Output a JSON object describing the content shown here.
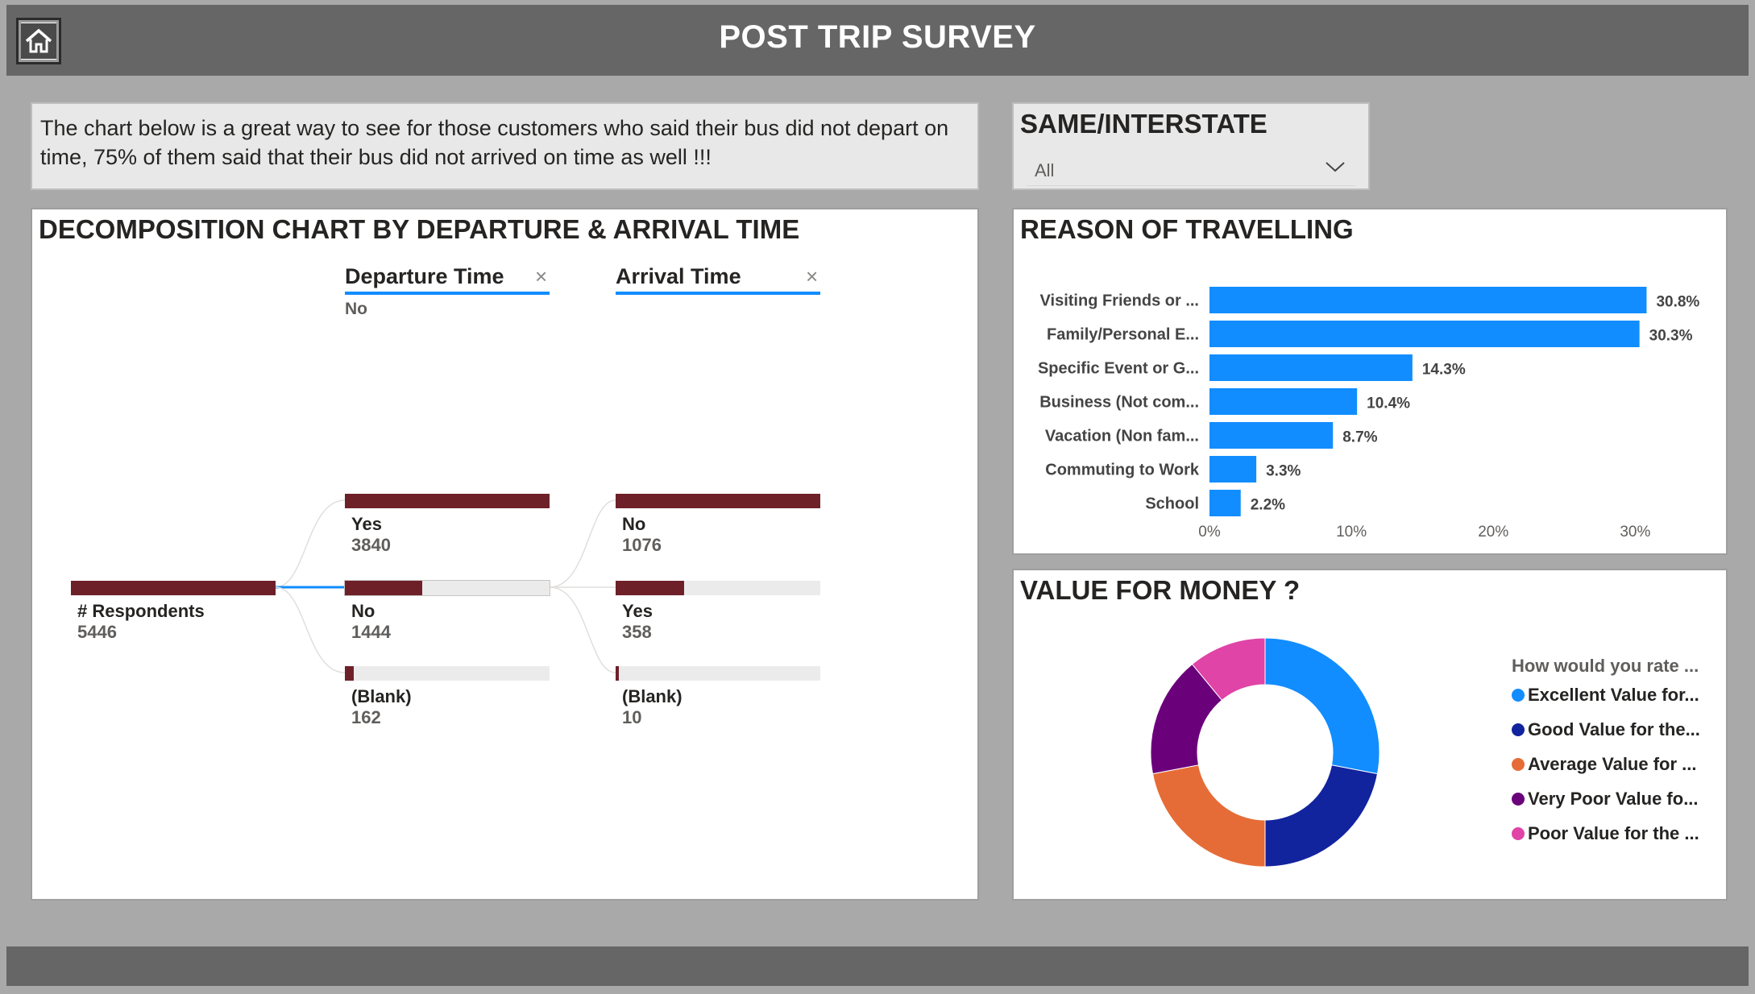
{
  "header": {
    "title": "POST TRIP SURVEY"
  },
  "info_text": "The chart below is a great way to see for those customers who said their bus did not depart on time, 75% of them said that their bus did not arrived on time as well !!!",
  "slicer": {
    "title": "SAME/INTERSTATE",
    "selected": "All"
  },
  "decomposition": {
    "title": "DECOMPOSITION CHART BY DEPARTURE & ARRIVAL TIME",
    "root": {
      "label": "# Respondents",
      "value": "5446",
      "fraction": 1.0
    },
    "level1": {
      "header": "Departure Time",
      "filter": "No",
      "nodes": [
        {
          "label": "Yes",
          "value": "3840",
          "fraction": 1.0
        },
        {
          "label": "No",
          "value": "1444",
          "fraction": 0.376
        },
        {
          "label": "(Blank)",
          "value": "162",
          "fraction": 0.042
        }
      ]
    },
    "level2": {
      "header": "Arrival Time",
      "nodes": [
        {
          "label": "No",
          "value": "1076",
          "fraction": 1.0
        },
        {
          "label": "Yes",
          "value": "358",
          "fraction": 0.333
        },
        {
          "label": "(Blank)",
          "value": "10",
          "fraction": 0.009
        }
      ]
    }
  },
  "reason_panel": {
    "title": "REASON OF TRAVELLING"
  },
  "value_panel": {
    "title": "VALUE FOR MONEY ?",
    "legend_title": "How would you rate ...",
    "legend": [
      {
        "label": "Excellent Value for...",
        "color": "#118dff"
      },
      {
        "label": "Good Value for the...",
        "color": "#12239e"
      },
      {
        "label": "Average Value for ...",
        "color": "#e66c37"
      },
      {
        "label": "Very Poor Value fo...",
        "color": "#6b007b"
      },
      {
        "label": "Poor Value for the ...",
        "color": "#e044a7"
      }
    ]
  },
  "chart_data": [
    {
      "type": "bar",
      "title": "REASON OF TRAVELLING",
      "orientation": "horizontal",
      "categories": [
        "Visiting Friends or ...",
        "Family/Personal E...",
        "Specific Event or G...",
        "Business (Not com...",
        "Vacation (Non fam...",
        "Commuting to Work",
        "School"
      ],
      "values": [
        30.8,
        30.3,
        14.3,
        10.4,
        8.7,
        3.3,
        2.2
      ],
      "data_labels": [
        "30.8%",
        "30.3%",
        "14.3%",
        "10.4%",
        "8.7%",
        "3.3%",
        "2.2%"
      ],
      "xticks": [
        "0%",
        "10%",
        "20%",
        "30%"
      ],
      "xlim": [
        0,
        33.5
      ],
      "color": "#118dff",
      "grid": false
    },
    {
      "type": "pie",
      "title": "VALUE FOR MONEY ?",
      "donut": true,
      "legend_title": "How would you rate ...",
      "legend_position": "right",
      "labels": [
        "Excellent Value for...",
        "Good Value for the...",
        "Average Value for ...",
        "Very Poor Value fo...",
        "Poor Value for the ..."
      ],
      "values": [
        28,
        22,
        22,
        17,
        11
      ],
      "colors": [
        "#118dff",
        "#12239e",
        "#e66c37",
        "#6b007b",
        "#e044a7"
      ]
    }
  ]
}
